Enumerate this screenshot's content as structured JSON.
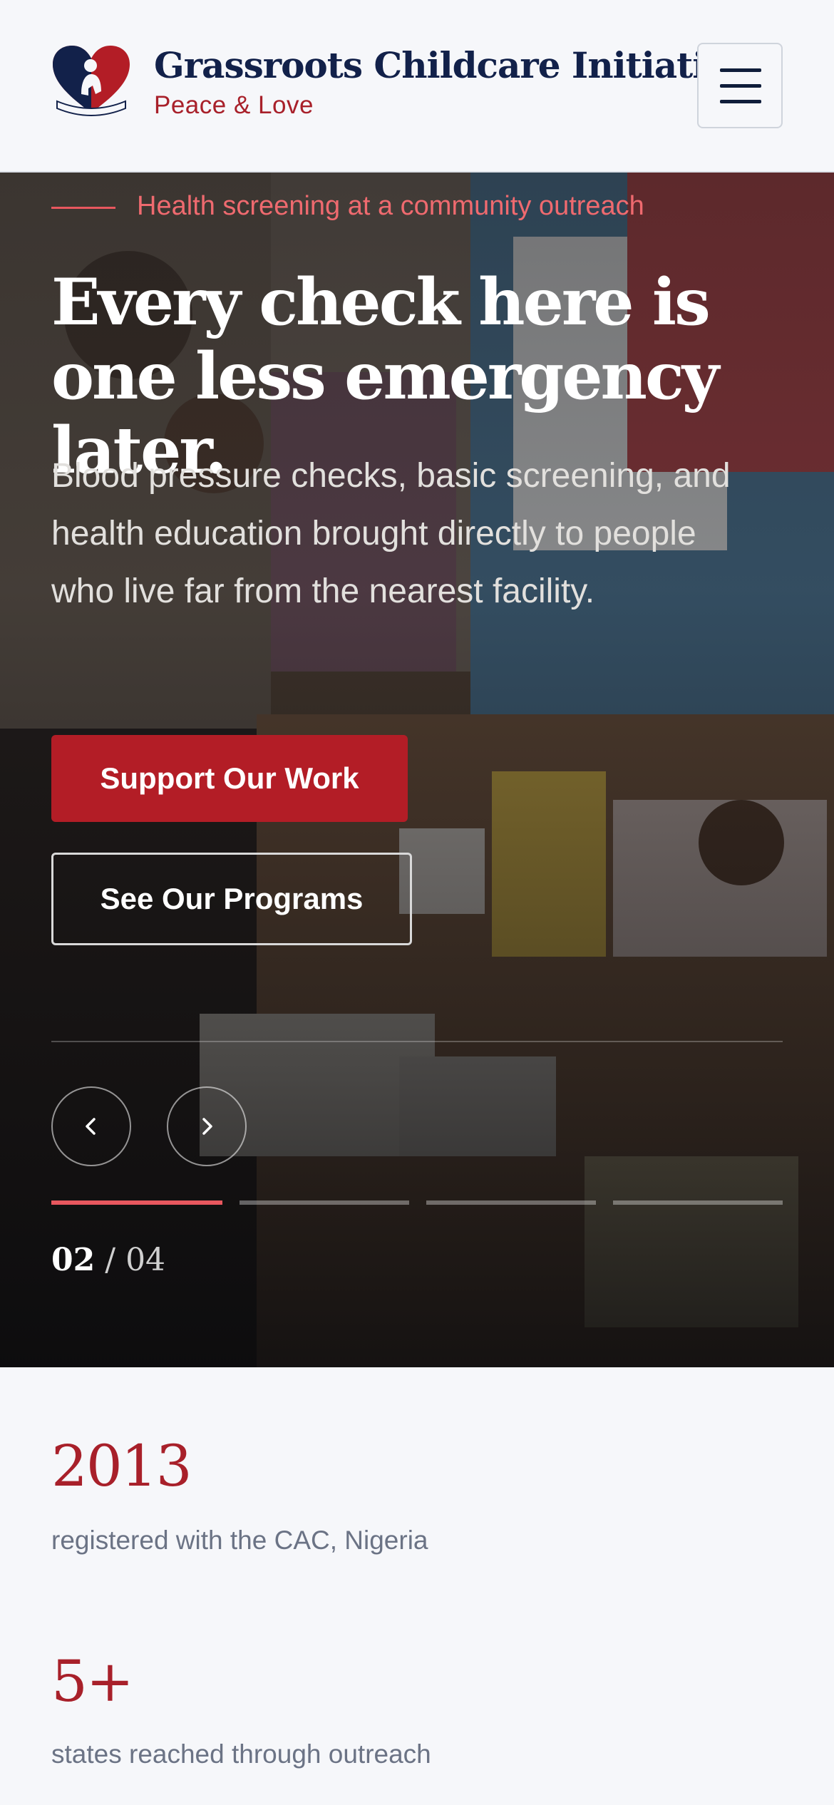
{
  "header": {
    "brand_title": "Grassroots Childcare Initiative",
    "brand_tagline": "Peace & Love",
    "menu_icon": "hamburger-icon"
  },
  "hero": {
    "eyebrow": "Health screening at a community outreach",
    "headline": "Every check here is one less emergency later.",
    "subtext": "Blood pressure checks, basic screening, and health education brought directly to people who live far from the nearest facility.",
    "primary_cta": "Support Our Work",
    "secondary_cta": "See Our Programs",
    "prev_icon": "chevron-left-icon",
    "next_icon": "chevron-right-icon",
    "slide_current": "02",
    "slide_separator": "/",
    "slide_total": "04",
    "active_slide_index": 1
  },
  "stats": [
    {
      "value": "2013",
      "label": "registered with the CAC, Nigeria"
    },
    {
      "value": "5+",
      "label": "states reached through outreach"
    }
  ],
  "colors": {
    "brand_red": "#b31d26",
    "accent_coral": "#e8575e",
    "navy": "#12214a",
    "page_bg": "#f6f7fa"
  }
}
